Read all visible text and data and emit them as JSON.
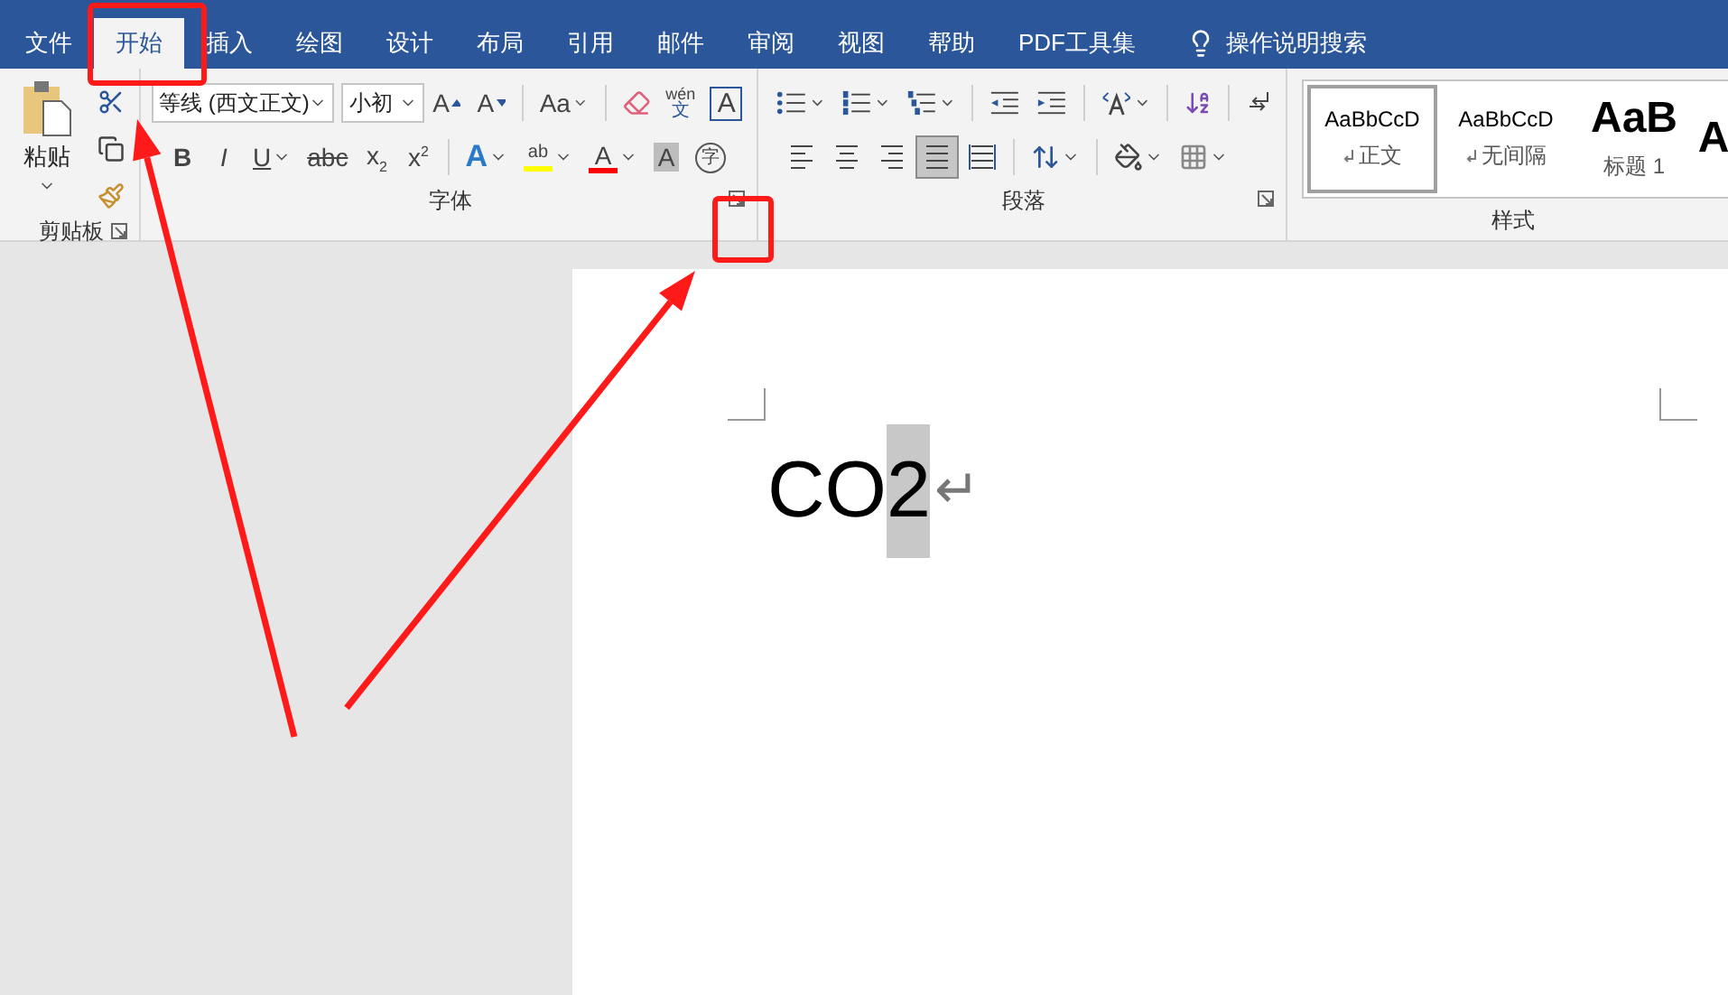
{
  "tabs": [
    {
      "label": "文件",
      "selected": false
    },
    {
      "label": "开始",
      "selected": true
    },
    {
      "label": "插入",
      "selected": false
    },
    {
      "label": "绘图",
      "selected": false
    },
    {
      "label": "设计",
      "selected": false
    },
    {
      "label": "布局",
      "selected": false
    },
    {
      "label": "引用",
      "selected": false
    },
    {
      "label": "邮件",
      "selected": false
    },
    {
      "label": "审阅",
      "selected": false
    },
    {
      "label": "视图",
      "selected": false
    },
    {
      "label": "帮助",
      "selected": false
    },
    {
      "label": "PDF工具集",
      "selected": false
    }
  ],
  "tell_me": {
    "label": "操作说明搜索"
  },
  "clipboard": {
    "paste": "粘贴",
    "title": "剪贴板"
  },
  "font": {
    "title": "字体",
    "font_name": "等线 (西文正文)",
    "font_size": "小初",
    "grow": "A",
    "shrink": "A",
    "change_case": "Aa",
    "phonetic_pinyin": "wén",
    "phonetic_char": "文",
    "bordered": "A",
    "format": [
      {
        "kind": "bold",
        "text": "B"
      },
      {
        "kind": "italic",
        "text": "I"
      },
      {
        "kind": "underline",
        "text": "U"
      },
      {
        "kind": "strike",
        "text": "abc"
      },
      {
        "kind": "sub",
        "text": "x",
        "script": "2"
      },
      {
        "kind": "sup",
        "text": "x",
        "script": "2"
      }
    ],
    "effects": "A",
    "highlight_letters": "ab",
    "font_color_letter": "A",
    "shaded": "A",
    "enclosed": "字"
  },
  "paragraph": {
    "title": "段落",
    "alignment": [
      {
        "kind": "left",
        "selected": false
      },
      {
        "kind": "center",
        "selected": false
      },
      {
        "kind": "right",
        "selected": false
      },
      {
        "kind": "justify",
        "selected": true
      },
      {
        "kind": "distributed",
        "selected": false
      }
    ]
  },
  "styles": {
    "title": "样式",
    "items": [
      {
        "kind": "normal",
        "preview": "AaBbCcD",
        "label": "正文",
        "para_mark": true,
        "selected": true
      },
      {
        "kind": "normal",
        "preview": "AaBbCcD",
        "label": "无间隔",
        "para_mark": true,
        "selected": false
      },
      {
        "kind": "heading",
        "preview": "AaB",
        "label": "标题 1",
        "para_mark": false,
        "selected": false
      },
      {
        "kind": "heading",
        "preview": "A",
        "selected": false
      }
    ]
  },
  "document": {
    "runs": [
      {
        "text": "CO",
        "selected": false
      },
      {
        "text": "2",
        "selected": true
      }
    ],
    "return_mark": "↵"
  }
}
